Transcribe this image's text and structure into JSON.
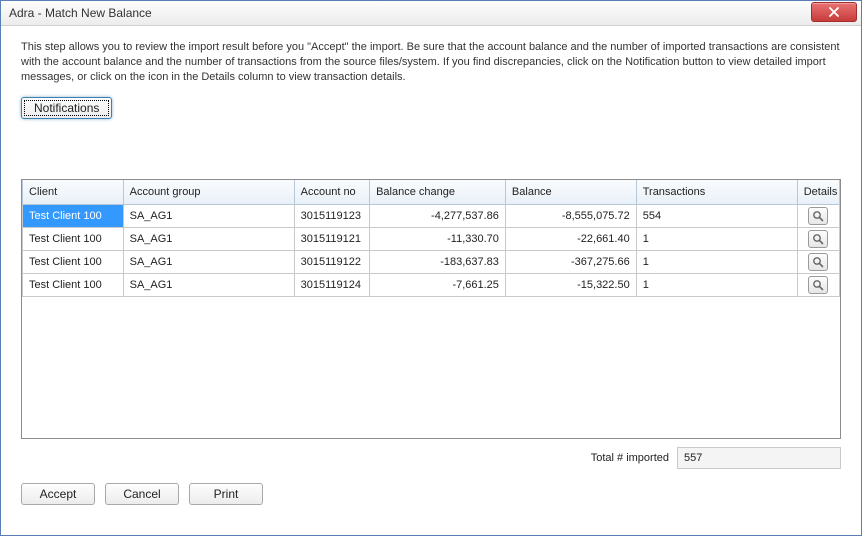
{
  "window": {
    "title": "Adra - Match New Balance"
  },
  "intro_text": "This step allows you to review the import result before you \"Accept\" the import. Be sure that the account balance and the number of imported transactions are consistent with the account balance and the number of transactions from the source files/system. If you find discrepancies, click on the Notification button to view detailed import messages, or click on the icon in the Details column to view transaction details.",
  "buttons": {
    "notifications": "Notifications",
    "accept": "Accept",
    "cancel": "Cancel",
    "print": "Print"
  },
  "grid": {
    "headers": {
      "client": "Client",
      "account_group": "Account group",
      "account_no": "Account no",
      "balance_change": "Balance change",
      "balance": "Balance",
      "transactions": "Transactions",
      "details": "Details"
    },
    "rows": [
      {
        "client": "Test Client 100",
        "account_group": "SA_AG1",
        "account_no": "3015119123",
        "balance_change": "-4,277,537.86",
        "balance": "-8,555,075.72",
        "transactions": "554"
      },
      {
        "client": "Test Client 100",
        "account_group": "SA_AG1",
        "account_no": "3015119121",
        "balance_change": "-11,330.70",
        "balance": "-22,661.40",
        "transactions": "1"
      },
      {
        "client": "Test Client 100",
        "account_group": "SA_AG1",
        "account_no": "3015119122",
        "balance_change": "-183,637.83",
        "balance": "-367,275.66",
        "transactions": "1"
      },
      {
        "client": "Test Client 100",
        "account_group": "SA_AG1",
        "account_no": "3015119124",
        "balance_change": "-7,661.25",
        "balance": "-15,322.50",
        "transactions": "1"
      }
    ]
  },
  "summary": {
    "label": "Total # imported",
    "value": "557"
  }
}
